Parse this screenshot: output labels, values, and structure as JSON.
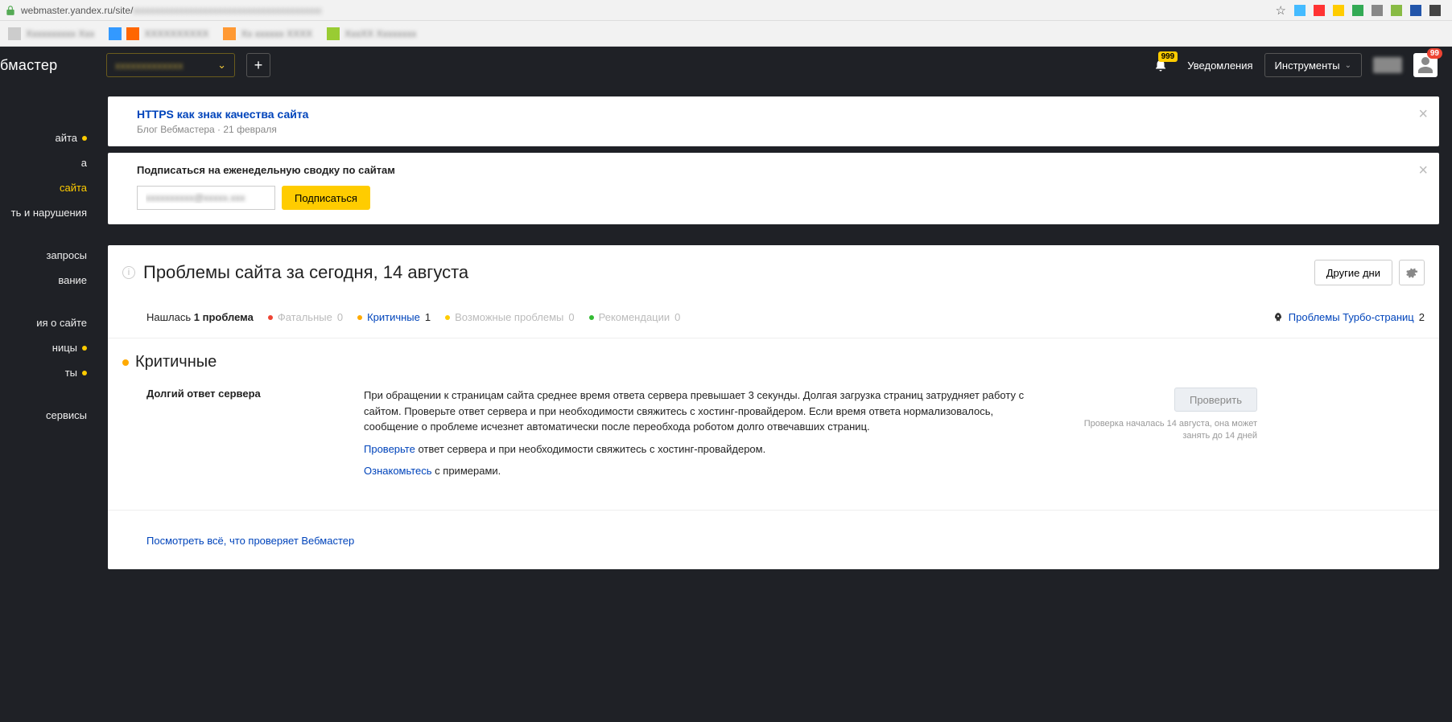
{
  "browser": {
    "url_prefix": "webmaster.yandex.ru/site/",
    "url_blurred": "xxxxxxxxxxxxxxxxxxxxxxxxxxxxxxxxxxxxxxx",
    "bookmarks": [
      "Xxxxxxxxxx Xxx",
      "XXXXXXXXXX",
      "Xx xxxxxx XXXX",
      "XxxXX Xxxxxxxx"
    ]
  },
  "header": {
    "logo": "бмастер",
    "site_selector": "xxxxxxxxxxxxx",
    "add_label": "+",
    "bell_badge": "999",
    "notifications_label": "Уведомления",
    "tools_label": "Инструменты",
    "avatar_badge": "99"
  },
  "sidebar": {
    "items": [
      {
        "label": "айта",
        "dot": true
      },
      {
        "label": "а"
      },
      {
        "label": "сайта",
        "active": true
      },
      {
        "label": "ть и нарушения"
      },
      {
        "label": "запросы",
        "mt": true
      },
      {
        "label": "вание"
      },
      {
        "label": "ия о сайте",
        "mt": true
      },
      {
        "label": "ницы",
        "dot": true
      },
      {
        "label": "ты",
        "dot": true
      },
      {
        "label": "сервисы",
        "mt": true
      }
    ]
  },
  "blog_banner": {
    "title": "HTTPS как знак качества сайта",
    "subtitle": "Блог Вебмастера · 21 февраля"
  },
  "subscribe": {
    "title": "Подписаться на еженедельную сводку по сайтам",
    "email_placeholder": "xxxxxxxxxx@xxxxx.xxx",
    "button": "Подписаться"
  },
  "problems": {
    "title": "Проблемы сайта за сегодня, 14 августа",
    "other_days": "Другие дни",
    "summary": {
      "found_prefix": "Нашлась ",
      "found_count": "1 проблема",
      "fatal_label": "Фатальные",
      "fatal_count": "0",
      "critical_label": "Критичные",
      "critical_count": "1",
      "possible_label": "Возможные проблемы",
      "possible_count": "0",
      "recom_label": "Рекомендации",
      "recom_count": "0",
      "turbo_label": "Проблемы Турбо-страниц",
      "turbo_count": "2"
    },
    "section_title": "Критичные",
    "issue": {
      "name": "Долгий ответ сервера",
      "desc1": "При обращении к страницам сайта среднее время ответа сервера превышает 3 секунды. Долгая загрузка страниц затрудняет работу с сайтом. Проверьте ответ сервера и при необходимости свяжитесь с хостинг-провайдером. Если время ответа нормализовалось, сообщение о проблеме исчезнет автоматически после переобхода роботом долго отвечавших страниц.",
      "link1": "Проверьте",
      "desc2_tail": " ответ сервера и при необходимости свяжитесь с хостинг-провайдером.",
      "link2": "Ознакомьтесь",
      "desc3_tail": " с примерами.",
      "check_button": "Проверить",
      "check_note": "Проверка началась 14 августа, она может занять до 14 дней"
    },
    "footer_link": "Посмотреть всё, что проверяет Вебмастер"
  }
}
